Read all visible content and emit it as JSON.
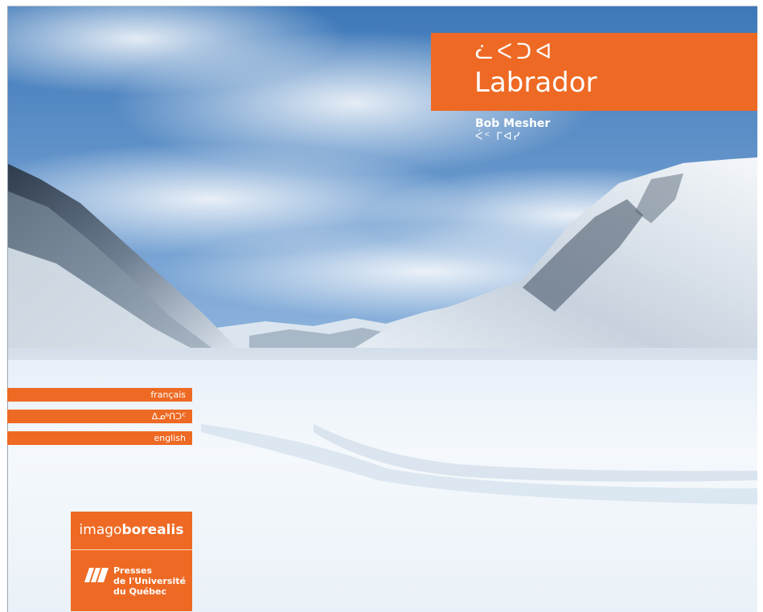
{
  "cover": {
    "title_syllabics": "ᓛᐸᑐᐊ",
    "title": "Labrador",
    "author": "Bob Mesher",
    "author_syllabics": "ᐹᑉ ᒥᐊᓯ"
  },
  "languages": [
    {
      "label": "français"
    },
    {
      "label": "ᐃᓄᒃᑎᑐᑦ"
    },
    {
      "label": "english"
    }
  ],
  "logo": {
    "series_light": "imago",
    "series_bold": "borealis",
    "publisher_line1": "Presses",
    "publisher_line2": "de l'Université",
    "publisher_line3": "du Québec"
  },
  "colors": {
    "accent": "#ee6a24",
    "sky": "#5f92c9",
    "snow": "#f2f7fb"
  }
}
